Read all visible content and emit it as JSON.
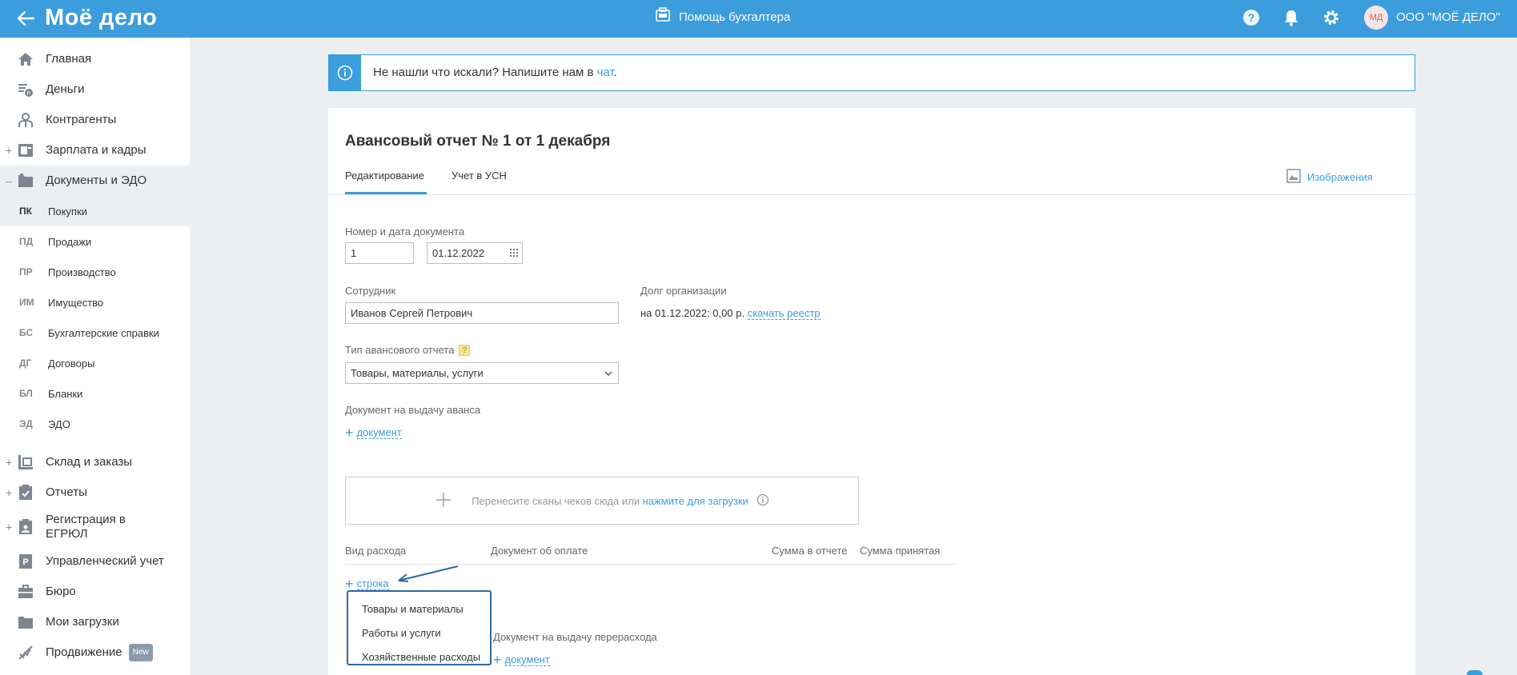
{
  "topbar": {
    "logo": "Моё дело",
    "help_center": "Помощь бухгалтера",
    "avatar_initials": "МД",
    "org_name": "ООО \"МОЁ ДЕЛО\""
  },
  "sidebar": {
    "items": [
      {
        "label": "Главная",
        "icon": "home-icon"
      },
      {
        "label": "Деньги",
        "icon": "money-icon"
      },
      {
        "label": "Контрагенты",
        "icon": "contractors-icon"
      },
      {
        "label": "Зарплата и кадры",
        "icon": "salary-icon",
        "expandable": "+"
      },
      {
        "label": "Документы и ЭДО",
        "icon": "folder-icon",
        "expandable": "–"
      }
    ],
    "sub_items": [
      {
        "abbr": "ПК",
        "label": "Покупки"
      },
      {
        "abbr": "ПД",
        "label": "Продажи"
      },
      {
        "abbr": "ПР",
        "label": "Производство"
      },
      {
        "abbr": "ИМ",
        "label": "Имущество"
      },
      {
        "abbr": "БС",
        "label": "Бухгалтерские справки"
      },
      {
        "abbr": "ДГ",
        "label": "Договоры"
      },
      {
        "abbr": "БЛ",
        "label": "Бланки"
      },
      {
        "abbr": "ЭД",
        "label": "ЭДО"
      }
    ],
    "items2": [
      {
        "label": "Склад и заказы",
        "icon": "warehouse-icon",
        "expandable": "+"
      },
      {
        "label": "Отчеты",
        "icon": "reports-icon",
        "expandable": "+"
      },
      {
        "label": "Регистрация в",
        "label2": "ЕГРЮЛ",
        "icon": "registration-icon",
        "expandable": "+"
      },
      {
        "label": "Управленческий учет",
        "icon": "management-icon"
      },
      {
        "label": "Бюро",
        "icon": "briefcase-icon"
      },
      {
        "label": "Мои загрузки",
        "icon": "downloads-icon"
      },
      {
        "label": "Продвижение",
        "icon": "promotion-icon",
        "badge": "New"
      }
    ]
  },
  "banner": {
    "text": "Не нашли что искали? Напишите нам в ",
    "link": "чат",
    "tail": "."
  },
  "document": {
    "title": "Авансовый отчет № 1 от 1 декабря",
    "tabs": [
      "Редактирование",
      "Учет в УСН"
    ],
    "images_link": "Изображения",
    "number_date_label": "Номер и дата документа",
    "number_value": "1",
    "date_value": "01.12.2022",
    "employee_label": "Сотрудник",
    "employee_value": "Иванов Сергей Петрович",
    "debt_label": "Долг организации",
    "debt_text": "на 01.12.2022: 0,00 р.",
    "debt_link": "скачать реестр",
    "report_type_label": "Тип авансового отчета",
    "help_mark": "?",
    "report_type_value": "Товары, материалы, услуги",
    "advance_doc_label": "Документ на выдачу аванса",
    "add_document": "документ",
    "dropzone_text": "Перенесите сканы чеков сюда или ",
    "dropzone_link": "нажмите для загрузки",
    "columns": [
      "Вид расхода",
      "Документ об оплате",
      "Сумма в отчете",
      "Сумма принятая"
    ],
    "add_row": "строка",
    "overspend_label": "Документ на выдачу перерасхода",
    "add_overspend_document": "документ"
  },
  "dropdown": {
    "options": [
      "Товары и материалы",
      "Работы и услуги",
      "Хозяйственные расходы"
    ]
  },
  "colors": {
    "brand": "#3b9ddc",
    "dropdown_border": "#2d6aa6",
    "annotation_arrow": "#2d6aa6"
  }
}
